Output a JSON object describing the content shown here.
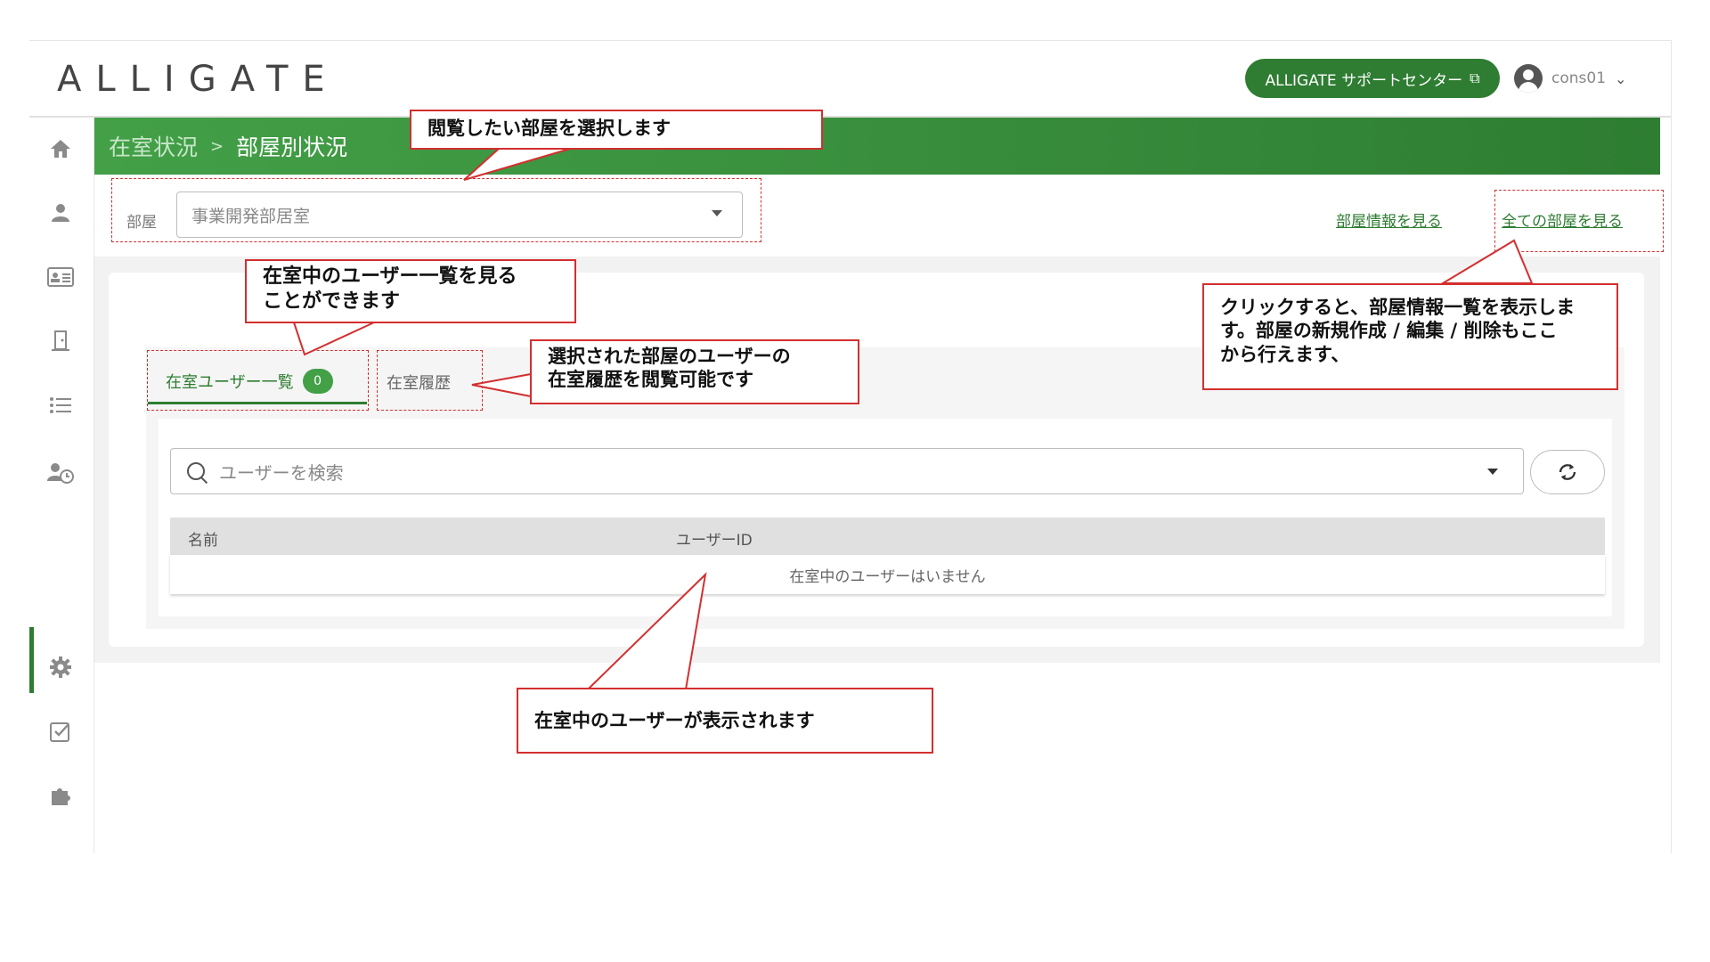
{
  "header": {
    "logo": "ALLIGATE",
    "support_button": "ALLIGATE サポートセンター",
    "user_name": "cons01"
  },
  "sidebar": {
    "icons": [
      "home-icon",
      "user-icon",
      "id-card-icon",
      "door-icon",
      "list-icon",
      "user-clock-icon",
      "gear-icon",
      "checkbox-icon",
      "puzzle-icon"
    ]
  },
  "breadcrumb": {
    "parent": "在室状況",
    "separator": ">",
    "current": "部屋別状況"
  },
  "room": {
    "label": "部屋",
    "selected": "事業開発部居室"
  },
  "links": {
    "room_info": "部屋情報を見る",
    "all_rooms": "全ての部屋を見る"
  },
  "tabs": {
    "active_label": "在室ユーザー一覧",
    "active_count": "0",
    "history_label": "在室履歴"
  },
  "search": {
    "placeholder": "ユーザーを検索"
  },
  "table": {
    "columns": [
      "名前",
      "ユーザーID"
    ],
    "empty_message": "在室中のユーザーはいません"
  },
  "annotations": {
    "select_room": "閲覧したい部屋を選択します",
    "user_list_line1": "在室中のユーザー一覧を見る",
    "user_list_line2": "ことができます",
    "history_line1": "選択された部屋のユーザーの",
    "history_line2": "在室履歴を閲覧可能です",
    "all_rooms_line1": "クリックすると、部屋情報一覧を表示しま",
    "all_rooms_line2": "す。部屋の新規作成 / 編集 / 削除もここ",
    "all_rooms_line3": "から行えます、",
    "shown_users": "在室中のユーザーが表示されます"
  },
  "colors": {
    "brand_green": "#2e7d32",
    "annotation_red": "#d32f2f"
  }
}
